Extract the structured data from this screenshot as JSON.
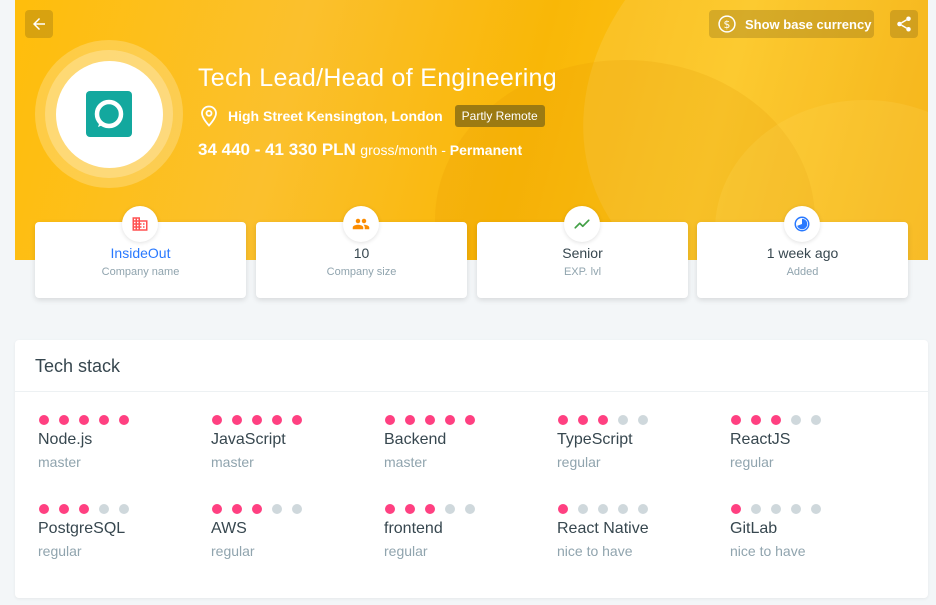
{
  "header": {
    "currency_button_label": "Show base currency",
    "job_title": "Tech Lead/Head of Engineering",
    "location": "High Street Kensington, London",
    "remote_badge": "Partly Remote",
    "salary_range": "34 440 - 41 330 PLN",
    "salary_period": "gross/month",
    "salary_sep": " - ",
    "employment_type": "Permanent"
  },
  "info_cards": [
    {
      "value": "InsideOut",
      "label": "Company name",
      "icon": "building-icon",
      "color": "#ff5252"
    },
    {
      "value": "10",
      "label": "Company size",
      "icon": "people-icon",
      "color": "#fb8c00"
    },
    {
      "value": "Senior",
      "label": "EXP. lvl",
      "icon": "trend-up-icon",
      "color": "#43a047"
    },
    {
      "value": "1 week ago",
      "label": "Added",
      "icon": "clock-icon",
      "color": "#2979ff"
    }
  ],
  "tech_stack": {
    "title": "Tech stack",
    "skills": [
      {
        "name": "Node.js",
        "level": "master",
        "dots": 5
      },
      {
        "name": "JavaScript",
        "level": "master",
        "dots": 5
      },
      {
        "name": "Backend",
        "level": "master",
        "dots": 5
      },
      {
        "name": "TypeScript",
        "level": "regular",
        "dots": 3
      },
      {
        "name": "ReactJS",
        "level": "regular",
        "dots": 3
      },
      {
        "name": "PostgreSQL",
        "level": "regular",
        "dots": 3
      },
      {
        "name": "AWS",
        "level": "regular",
        "dots": 3
      },
      {
        "name": "frontend",
        "level": "regular",
        "dots": 3
      },
      {
        "name": "React Native",
        "level": "nice to have",
        "dots": 1
      },
      {
        "name": "GitLab",
        "level": "nice to have",
        "dots": 1
      }
    ]
  },
  "colors": {
    "accent": "#ffbe0b",
    "dot_active": "#ff4081",
    "dot_inactive": "#cfd8dc",
    "link": "#2979ff",
    "logo": "#13a89e"
  }
}
